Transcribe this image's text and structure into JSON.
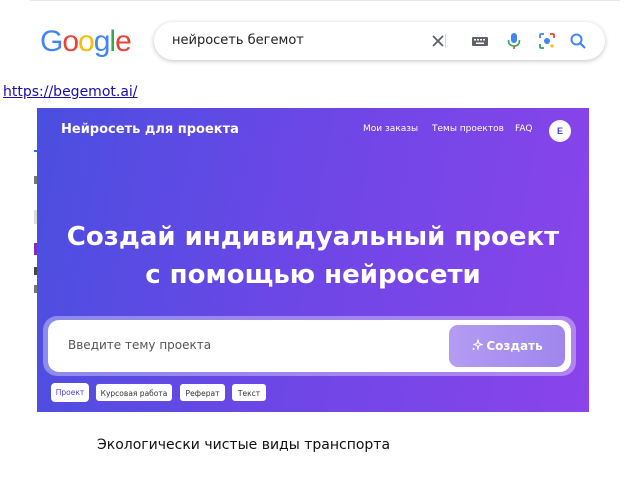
{
  "google": {
    "logo_letters": [
      {
        "ch": "G",
        "color": "#4285F4"
      },
      {
        "ch": "o",
        "color": "#EA4335"
      },
      {
        "ch": "o",
        "color": "#FBBC05"
      },
      {
        "ch": "g",
        "color": "#4285F4"
      },
      {
        "ch": "l",
        "color": "#34A853"
      },
      {
        "ch": "e",
        "color": "#EA4335"
      }
    ],
    "search_query": "нейросеть бегемот",
    "icons": [
      "close-icon",
      "keyboard-icon",
      "mic-icon",
      "lens-icon",
      "search-icon"
    ]
  },
  "result": {
    "url": "https://begemot.ai/"
  },
  "site": {
    "brand": "Нейросеть для проекта",
    "nav": [
      "Мои заказы",
      "Темы проектов",
      "FAQ"
    ],
    "avatar_letter": "E",
    "hero_line1": "Создай индивидуальный проект",
    "hero_line2": "с помощью нейросети",
    "input_placeholder": "Введите тему проекта",
    "create_label": "Создать",
    "chips": [
      "Проект",
      "Курсовая работа",
      "Реферат",
      "Текст"
    ],
    "gradient_start": "#4a4fe0",
    "gradient_end": "#8a44ea"
  },
  "caption": "Экологически чистые виды транспорта"
}
